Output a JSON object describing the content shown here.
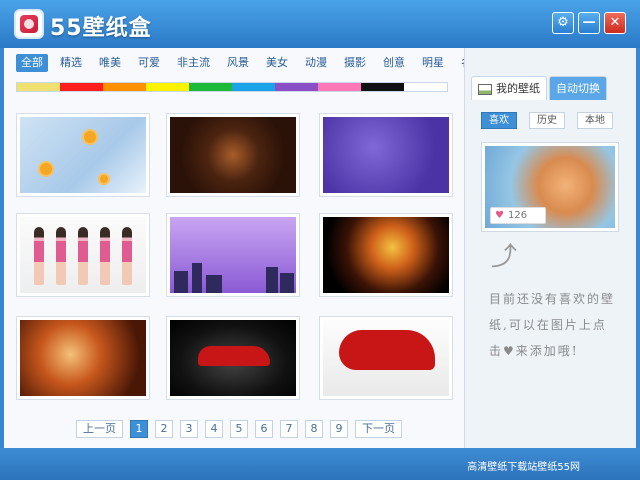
{
  "app": {
    "title": "55壁纸盒"
  },
  "window_controls": {
    "settings": "⚙",
    "minimize": "—",
    "close": "✕"
  },
  "categories": [
    "全部",
    "精选",
    "唯美",
    "可爱",
    "非主流",
    "风景",
    "美女",
    "动漫",
    "摄影",
    "创意",
    "明星",
    "名车"
  ],
  "color_filters": [
    "#f0e070",
    "#ff1e1e",
    "#ff9000",
    "#fff200",
    "#1dba3a",
    "#1aa3e8",
    "#8a4fc6",
    "#ff79b8",
    "#111111",
    "#ffffff"
  ],
  "thumbnails": [
    {
      "name": "daisies-on-sky"
    },
    {
      "name": "cute-candy-sticks"
    },
    {
      "name": "purple-apple-logo"
    },
    {
      "name": "girl-group-pink"
    },
    {
      "name": "cartoon-couple-city"
    },
    {
      "name": "fire-phoenix"
    },
    {
      "name": "singer-with-mic"
    },
    {
      "name": "red-sportscar-dark"
    },
    {
      "name": "red-sportscar-white"
    }
  ],
  "pagination": {
    "prev": "上一页",
    "pages": [
      "1",
      "2",
      "3",
      "4",
      "5",
      "6",
      "7",
      "8",
      "9"
    ],
    "next": "下一页",
    "current": "1"
  },
  "sidebar": {
    "tabs": [
      "我的壁纸",
      "自动切换"
    ],
    "sub_tabs": [
      "喜欢",
      "历史",
      "本地"
    ],
    "like_count": "126",
    "hint": "目前还没有喜欢的壁纸,可以在图片上点击♥来添加哦!"
  },
  "status": {
    "text": "高清壁纸下载站壁纸55网"
  }
}
